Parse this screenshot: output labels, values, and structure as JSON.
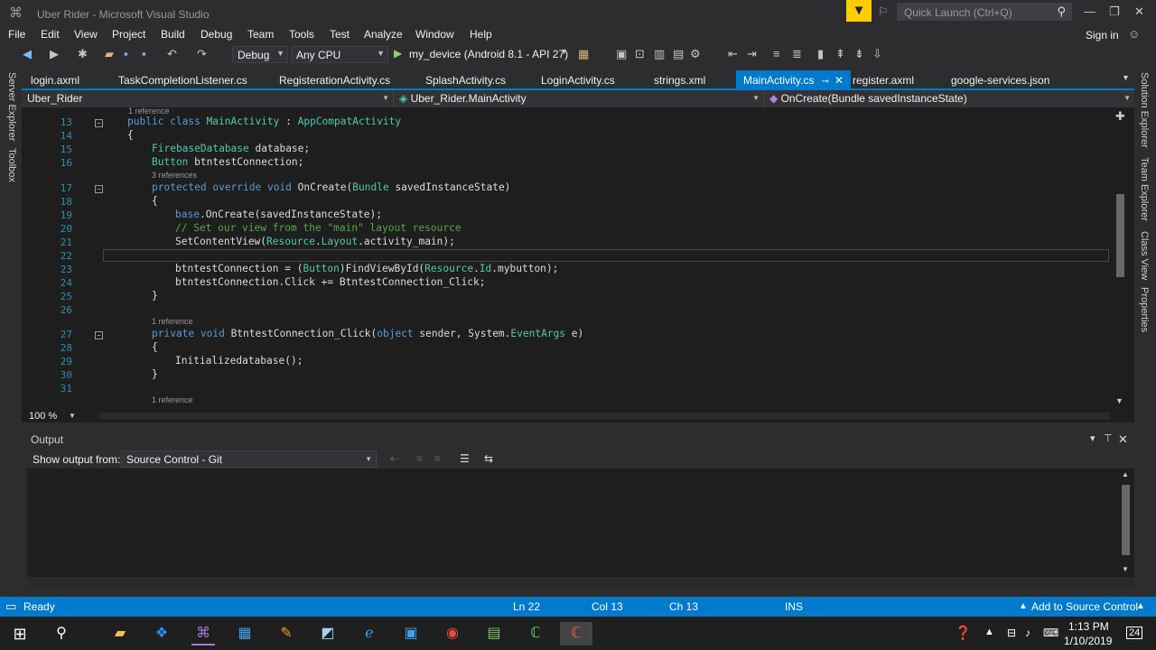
{
  "window": {
    "title": "Uber Rider - Microsoft Visual Studio",
    "quick_launch_placeholder": "Quick Launch (Ctrl+Q)"
  },
  "menu": [
    "File",
    "Edit",
    "View",
    "Project",
    "Build",
    "Debug",
    "Team",
    "Tools",
    "Test",
    "Analyze",
    "Window",
    "Help"
  ],
  "sign_in": "Sign in",
  "toolbar": {
    "config": "Debug",
    "platform": "Any CPU",
    "run_target": "my_device (Android 8.1 - API 27)"
  },
  "left_tools": [
    "Server Explorer",
    "Toolbox"
  ],
  "right_tools": [
    "Solution Explorer",
    "Team Explorer",
    "Class View",
    "Properties"
  ],
  "tabs": [
    "login.axml",
    "TaskCompletionListener.cs",
    "RegisterationActivity.cs",
    "SplashActivity.cs",
    "LoginActivity.cs",
    "strings.xml",
    "MainActivity.cs",
    "register.axml",
    "google-services.json"
  ],
  "active_tab": "MainActivity.cs",
  "navbar": {
    "project": "Uber_Rider",
    "type": "Uber_Rider.MainActivity",
    "member": "OnCreate(Bundle savedInstanceState)"
  },
  "editor": {
    "refs": {
      "r0": "1 reference",
      "r1": "3 references",
      "r2": "1 reference",
      "r3": "1 reference"
    },
    "line_numbers": [
      "13",
      "14",
      "15",
      "16",
      "17",
      "18",
      "19",
      "20",
      "21",
      "22",
      "23",
      "24",
      "25",
      "26",
      "27",
      "28",
      "29",
      "30",
      "31"
    ],
    "lines": {
      "l13": [
        "public class ",
        "MainActivity",
        " : ",
        "AppCompatActivity"
      ],
      "l14": "{",
      "l15": [
        "FirebaseDatabase",
        " database;"
      ],
      "l16": [
        "Button",
        " btntestConnection;"
      ],
      "l17": [
        "protected override void ",
        "OnCreate(",
        "Bundle",
        " savedInstanceState)"
      ],
      "l18": "{",
      "l19": [
        "base",
        ".OnCreate(savedInstanceState);"
      ],
      "l20": "// Set our view from the \"main\" layout resource",
      "l21": [
        "SetContentView(",
        "Resource",
        ".",
        "Layout",
        ".activity_main);"
      ],
      "l23": [
        "btntestConnection = (",
        "Button",
        ")FindViewById(",
        "Resource",
        ".",
        "Id",
        ".mybutton);"
      ],
      "l24": "btntestConnection.Click += BtntestConnection_Click;",
      "l25": "}",
      "l27": [
        "private void ",
        "BtntestConnection_Click(",
        "object",
        " sender, System.",
        "EventArgs",
        " e)"
      ],
      "l28": "{",
      "l29": "Initializedatabase();",
      "l30": "}"
    }
  },
  "zoom": "100 %",
  "output": {
    "title": "Output",
    "show_from_label": "Show output from:",
    "source": "Source Control - Git"
  },
  "status": {
    "state": "Ready",
    "ln": "Ln 22",
    "col": "Col 13",
    "ch": "Ch 13",
    "mode": "INS",
    "right": "Add to Source Control"
  },
  "taskbar": {
    "time": "1:13 PM",
    "date": "1/10/2019",
    "notifications": "24"
  }
}
